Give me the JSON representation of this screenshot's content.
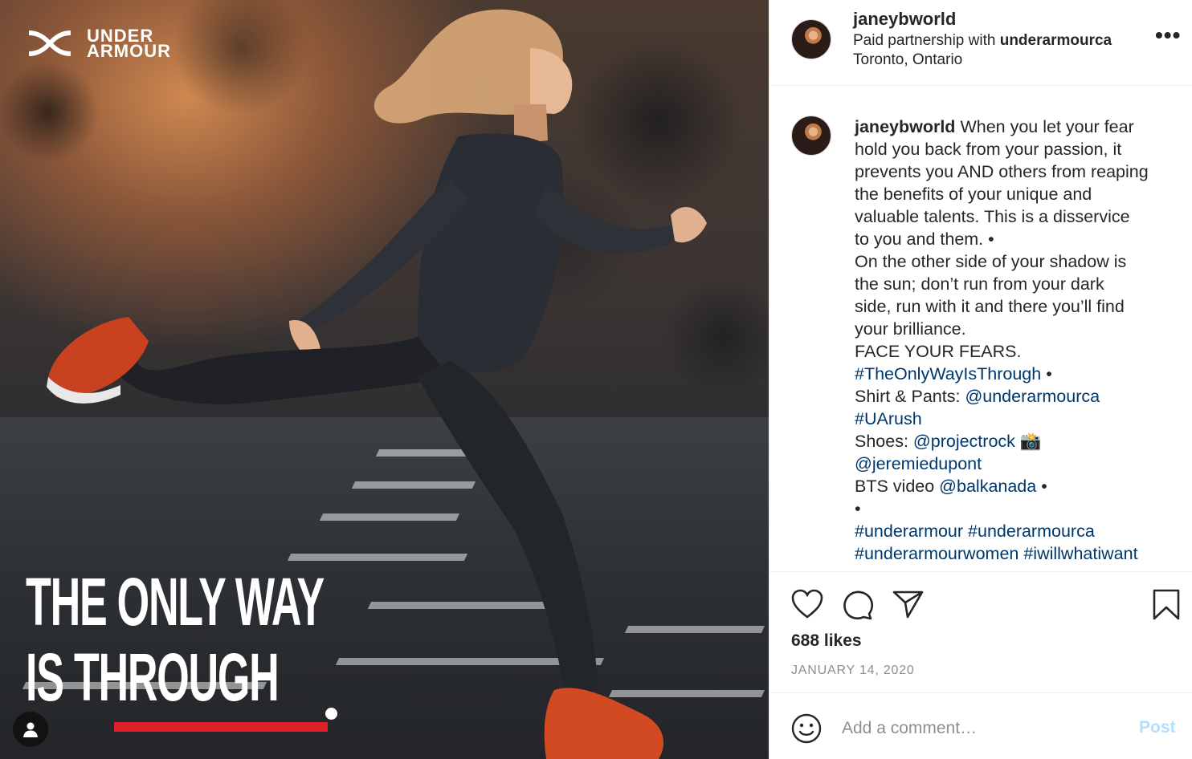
{
  "image": {
    "brand_text": "UNDER\nARMOUR",
    "headline_line1": "THE ONLY WAY",
    "headline_line2": "IS THROUGH",
    "accent_color": "#e0202a"
  },
  "header": {
    "username": "janeybworld",
    "partnership_prefix": "Paid partnership with",
    "partner": "underarmourca",
    "location": "Toronto, Ontario",
    "more_label": "•••"
  },
  "caption": {
    "username": "janeybworld",
    "lines": [
      "When you let your fear",
      "hold you back from your passion, it",
      "prevents you AND others from reaping",
      "the benefits of your unique and",
      "valuable talents. This is a disservice",
      "to you and them. •",
      "On the other side of your shadow is",
      "the sun; don’t run from your dark",
      "side, run with it and there you’ll find",
      "your brilliance.",
      "FACE YOUR FEARS."
    ],
    "hashtag_1": "#TheOnlyWayIsThrough",
    "bullet": "•",
    "shirt_label": "Shirt & Pants:",
    "shirt_mention": "@underarmourca",
    "hashtag_2": "#UArush",
    "shoes_label": "Shoes:",
    "shoes_mention": "@projectrock",
    "camera_emoji": "📸",
    "photographer": "@jeremiedupont",
    "bts_label": "BTS video",
    "bts_mention": "@balkanada",
    "tags_line1_a": "#underarmour",
    "tags_line1_b": "#underarmourca",
    "tags_line2_a": "#underarmourwomen",
    "tags_line2_b": "#iwillwhatiwant"
  },
  "engagement": {
    "likes": "688 likes",
    "date": "JANUARY 14, 2020"
  },
  "comment": {
    "placeholder": "Add a comment…",
    "post_label": "Post"
  },
  "colors": {
    "link": "#00376b",
    "post_disabled": "#b2dffc",
    "secondary_text": "#8e8e8e"
  }
}
